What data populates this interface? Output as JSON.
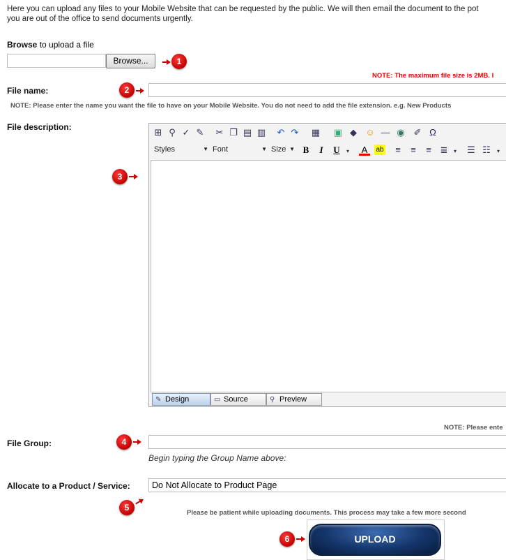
{
  "intro": {
    "line1": "Here you can upload any files to your Mobile Website that can be requested by the public. We will then email the document to the pot",
    "line2": "you are out of the office to send documents urgently."
  },
  "browse": {
    "label_bold": "Browse",
    "label_rest": "to upload a file",
    "button_label": "Browse...",
    "value": ""
  },
  "notes": {
    "max_size": "NOTE: The maximum file size is 2MB. I",
    "file_name": "NOTE: Please enter the name you want the file to have on your Mobile Website. You do not need to add the file extension. e.g. New Products",
    "group": "NOTE: Please ente",
    "patience": "Please be patient while uploading documents. This process may take a few more second"
  },
  "file_name": {
    "label": "File name:",
    "value": ""
  },
  "file_description": {
    "label": "File description:",
    "toolbar": {
      "styles": "Styles",
      "font": "Font",
      "size": "Size"
    },
    "tabs": [
      {
        "label": "Design",
        "icon": "design-icon",
        "active": true
      },
      {
        "label": "Source",
        "icon": "source-icon",
        "active": false
      },
      {
        "label": "Preview",
        "icon": "preview-icon",
        "active": false
      }
    ],
    "content": ""
  },
  "file_group": {
    "label": "File Group:",
    "value": "",
    "hint": "Begin typing the Group Name above:"
  },
  "allocate": {
    "label": "Allocate to a Product / Service:",
    "selected": "Do Not Allocate to Product Page"
  },
  "upload": {
    "label": "UPLOAD"
  },
  "badges": [
    "1",
    "2",
    "3",
    "4",
    "5",
    "6"
  ],
  "colors": {
    "badge": "#d00000",
    "note_red": "#ee0000",
    "upload_button": "#14356a"
  }
}
